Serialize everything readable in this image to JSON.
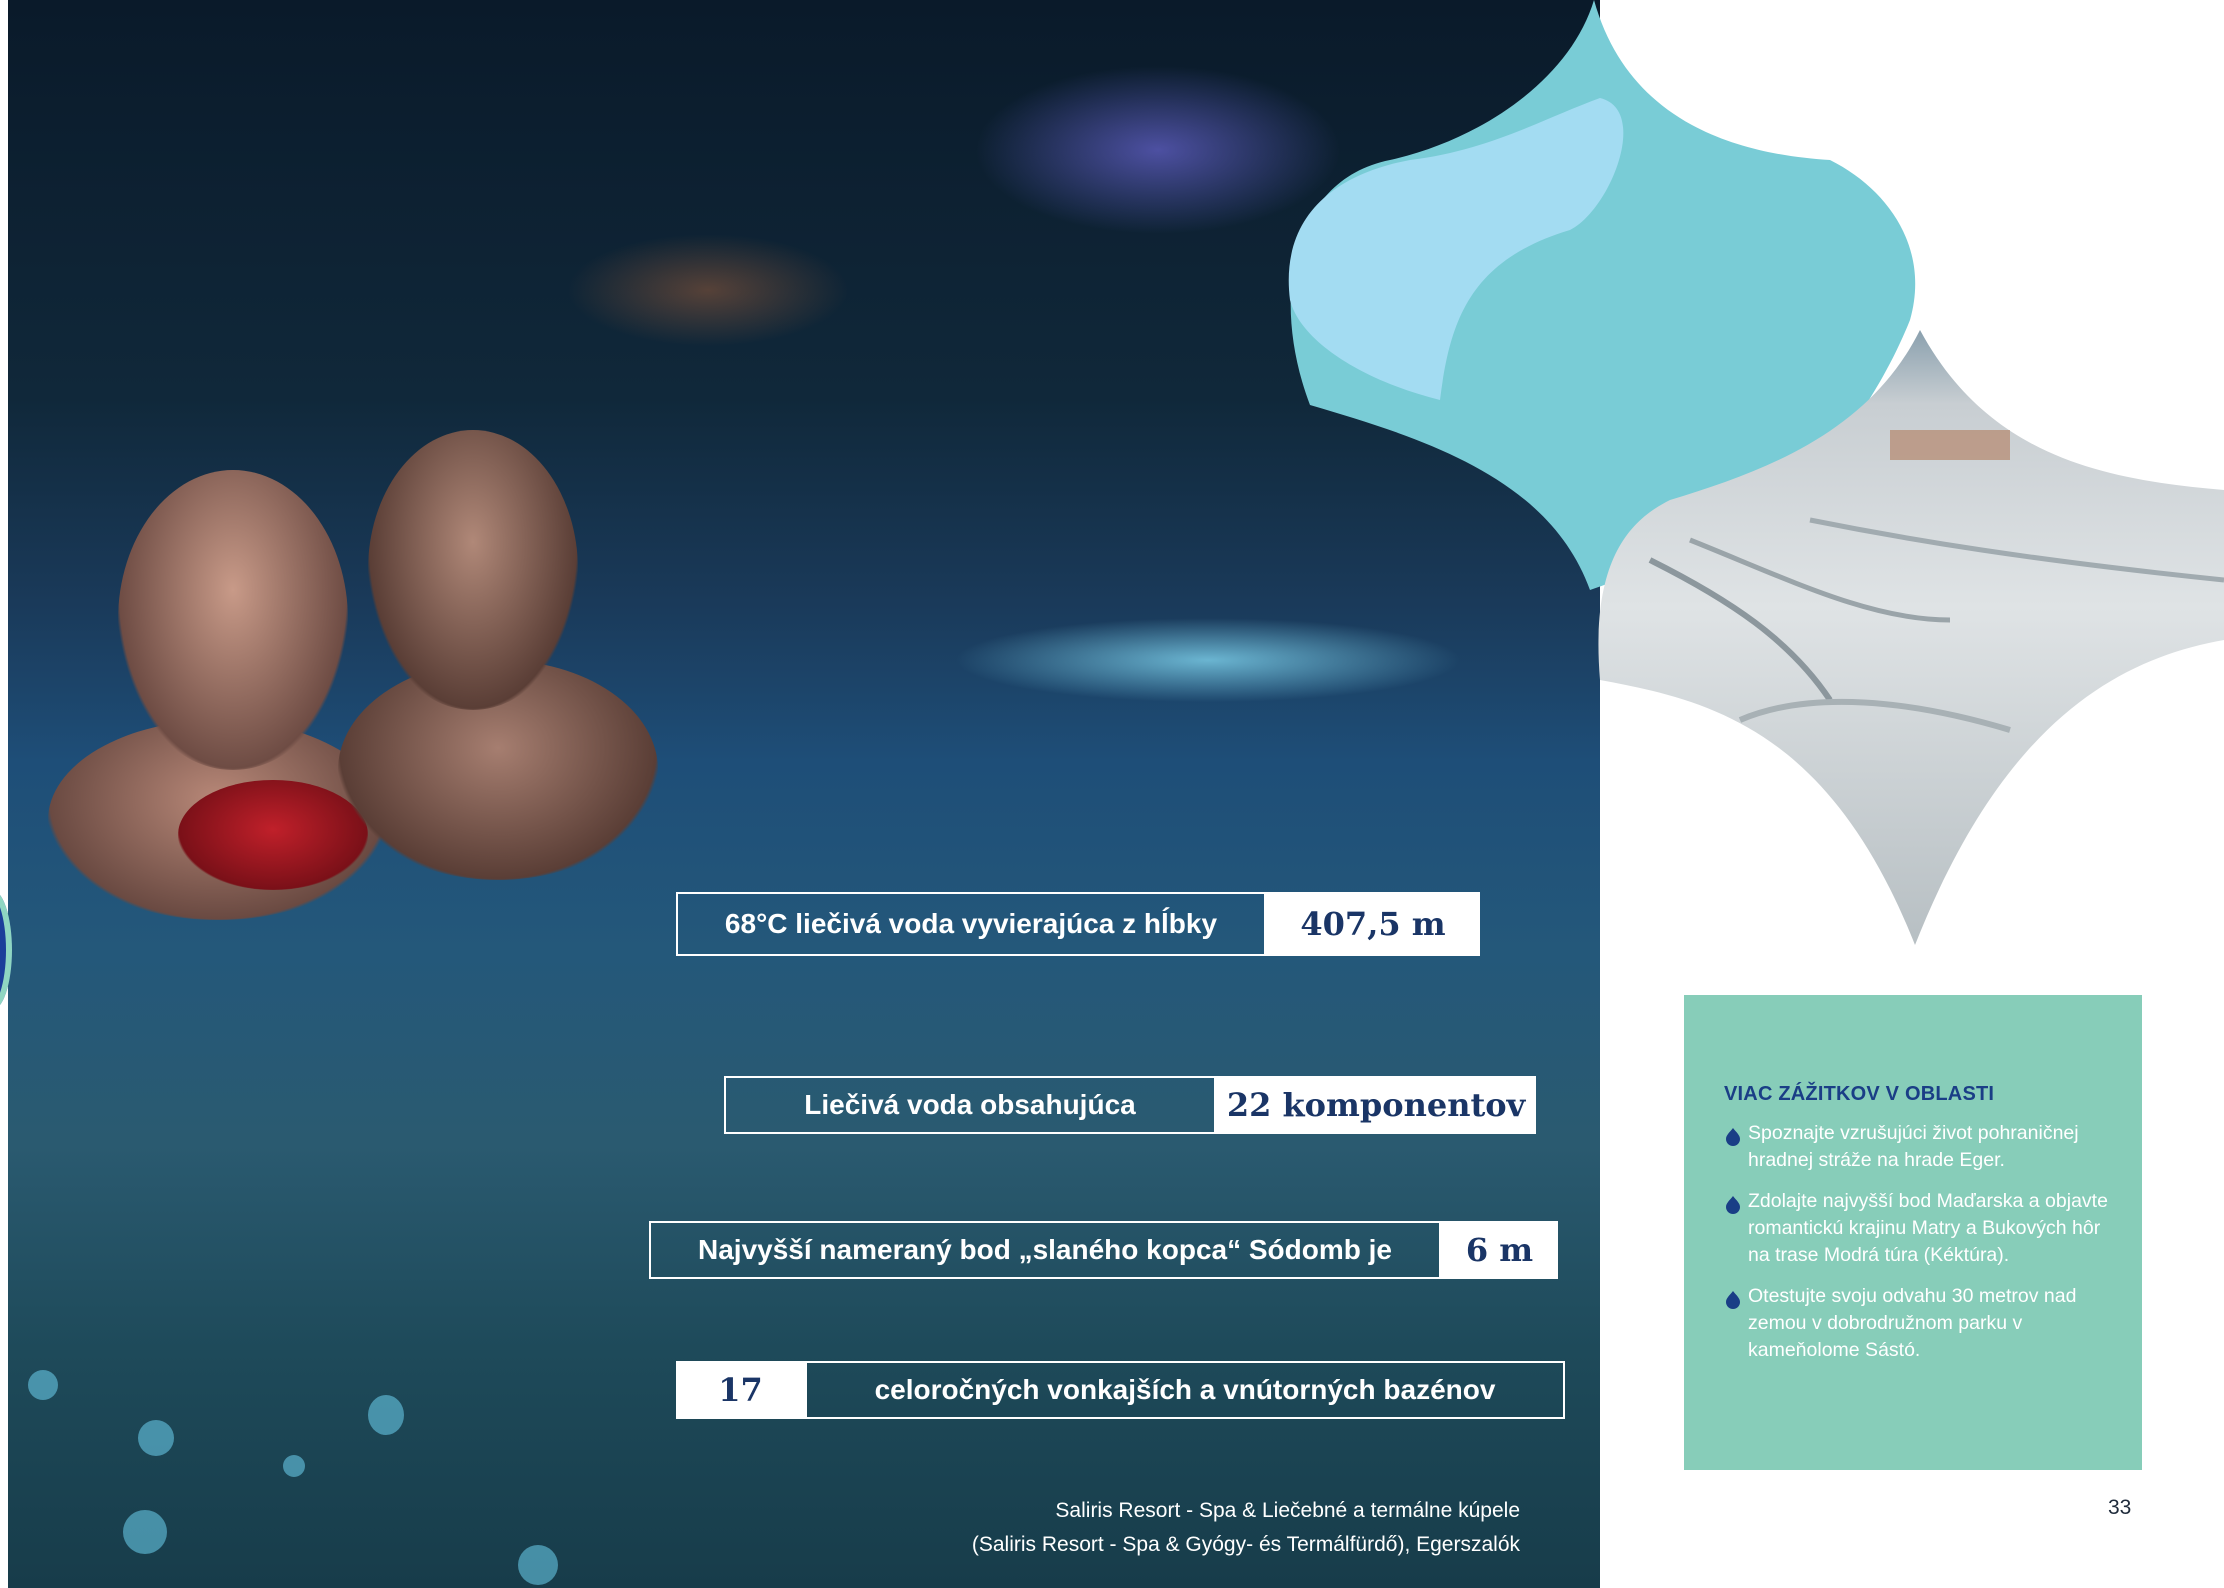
{
  "stats": [
    {
      "label": "68°C liečivá voda vyvierajúca z hĺbky",
      "value": "407,5 m"
    },
    {
      "label": "Liečivá voda obsahujúca",
      "value": "22 komponentov"
    },
    {
      "label": "Najvyšší nameraný bod „slaného kopca“ Sódomb je",
      "value": "6 m"
    },
    {
      "label": "celoročných vonkajších a vnútorných bazénov",
      "value": "17"
    }
  ],
  "credit": {
    "line1": "Saliris Resort - Spa & Liečebné a termálne kúpele",
    "line2": "(Saliris Resort - Spa & Gyógy- és Termálfürdő), Egerszalók"
  },
  "info": {
    "title": "VIAC ZÁŽITKOV V OBLASTI",
    "items": [
      "Spoznajte vzrušujúci život pohraničnej hradnej stráže na hrade Eger.",
      "Zdolajte najvyšší bod Maďarska a objavte romantickú krajinu Matry a Bukových hôr na trase Modrá túra (Kéktúra).",
      "Otestujte svoju odvahu 30 metrov nad zemou v dobrodružnom parku v kameňolome Sástó."
    ]
  },
  "page_number": "33",
  "colors": {
    "navy": "#1a3566",
    "info_bg": "#87cdb9",
    "teal_shape": "#79ccd6",
    "light_blue_shape": "#a3dcf2",
    "title_blue": "#1a3e86"
  },
  "icons": {
    "bullet": "water-drop-icon"
  }
}
